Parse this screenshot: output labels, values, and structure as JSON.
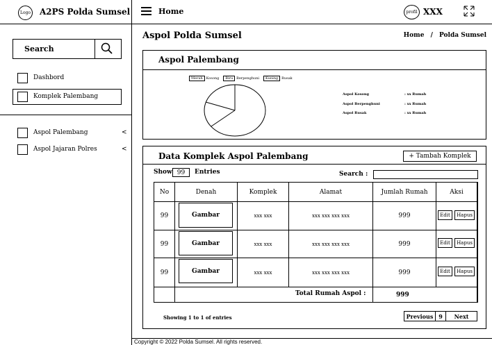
{
  "sidebar": {
    "logo_label": "Logo",
    "app_title": "A2PS Polda Sumsel",
    "search_label": "Search",
    "menu": [
      "Dashbord",
      "Komplek Palembang"
    ],
    "nav": [
      {
        "label": "Aspol Palembang",
        "chevron": "<"
      },
      {
        "label": "Aspol Jajaran Polres",
        "chevron": "<"
      }
    ]
  },
  "header": {
    "title": "Home",
    "profile_label": "profil",
    "user": "XXX"
  },
  "page": {
    "title": "Aspol Polda Sumsel",
    "breadcrumb": [
      "Home",
      "/",
      "Polda Sumsel"
    ]
  },
  "summary_panel": {
    "title": "Aspol Palembang",
    "legend": [
      {
        "color_label": "Merah",
        "text": "Kosong"
      },
      {
        "color_label": "Biru",
        "text": "Berpenghuni"
      },
      {
        "color_label": "Kuning",
        "text": "Rusak"
      }
    ],
    "stats": [
      {
        "label": "Aspol Kosong",
        "value": ": xx Rumah"
      },
      {
        "label": "Aspol Berpenghuni",
        "value": ": xx Rumah"
      },
      {
        "label": "Aspol Rusak",
        "value": ": xx Rumah"
      }
    ]
  },
  "table_panel": {
    "title": "Data Komplek Aspol Palembang",
    "add_button": "+ Tambah Komplek",
    "show_label": "Show",
    "entries_value": "99",
    "entries_label": "Entries",
    "search_label": "Search :",
    "columns": [
      "No",
      "Denah",
      "Komplek",
      "Alamat",
      "Jumlah Rumah",
      "Aksi"
    ],
    "rows": [
      {
        "no": "99",
        "denah": "Gambar",
        "komplek": "xxx xxx",
        "alamat": "xxx xxx xxx xxx",
        "jumlah": "999",
        "edit": "Edit",
        "hapus": "Hapus"
      },
      {
        "no": "99",
        "denah": "Gambar",
        "komplek": "xxx xxx",
        "alamat": "xxx xxx xxx xxx",
        "jumlah": "999",
        "edit": "Edit",
        "hapus": "Hapus"
      },
      {
        "no": "99",
        "denah": "Gambar",
        "komplek": "xxx xxx",
        "alamat": "xxx xxx xxx xxx",
        "jumlah": "999",
        "edit": "Edit",
        "hapus": "Hapus"
      }
    ],
    "total_label": "Total Rumah Aspol :",
    "total_value": "999",
    "showing_text": "Showing 1 to 1 of entries",
    "pagination": {
      "previous": "Previous",
      "page": "9",
      "next": "Next"
    }
  },
  "footer": {
    "copyright": "Copyright © 2022 Polda Sumsel. All rights reserved."
  }
}
